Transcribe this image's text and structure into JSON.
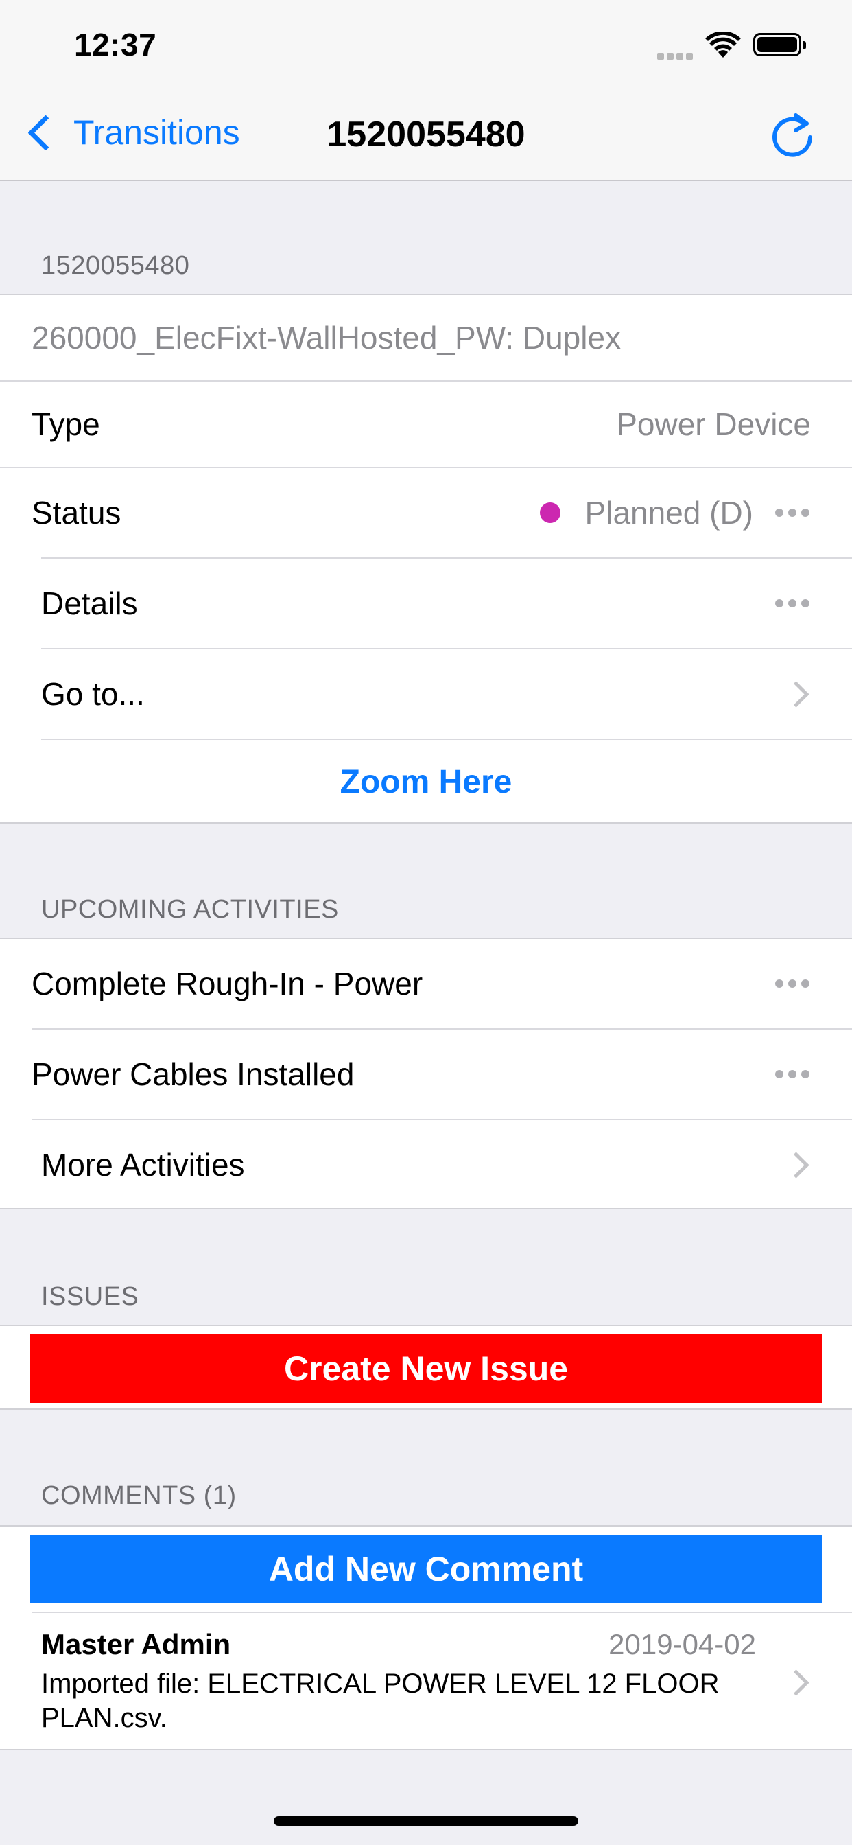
{
  "status_bar": {
    "time": "12:37"
  },
  "nav": {
    "back_label": "Transitions",
    "title": "1520055480"
  },
  "element": {
    "section_header": "1520055480",
    "name": "260000_ElecFixt-WallHosted_PW: Duplex",
    "type_label": "Type",
    "type_value": "Power Device",
    "status_label": "Status",
    "status_value": "Planned (D)",
    "status_color": "#cc27b0",
    "details_label": "Details",
    "goto_label": "Go to...",
    "zoom_label": "Zoom Here"
  },
  "activities": {
    "section_header": "UPCOMING ACTIVITIES",
    "items": [
      {
        "label": "Complete Rough-In - Power"
      },
      {
        "label": "Power Cables Installed"
      }
    ],
    "more_label": "More Activities"
  },
  "issues": {
    "section_header": "ISSUES",
    "create_label": "Create New Issue",
    "create_color": "#ff0000"
  },
  "comments": {
    "section_header": "COMMENTS (1)",
    "add_label": "Add New Comment",
    "add_color": "#0a7aff",
    "items": [
      {
        "author": "Master Admin",
        "date": "2019-04-02",
        "text": "Imported file: ELECTRICAL POWER LEVEL 12 FLOOR PLAN.csv."
      }
    ]
  }
}
